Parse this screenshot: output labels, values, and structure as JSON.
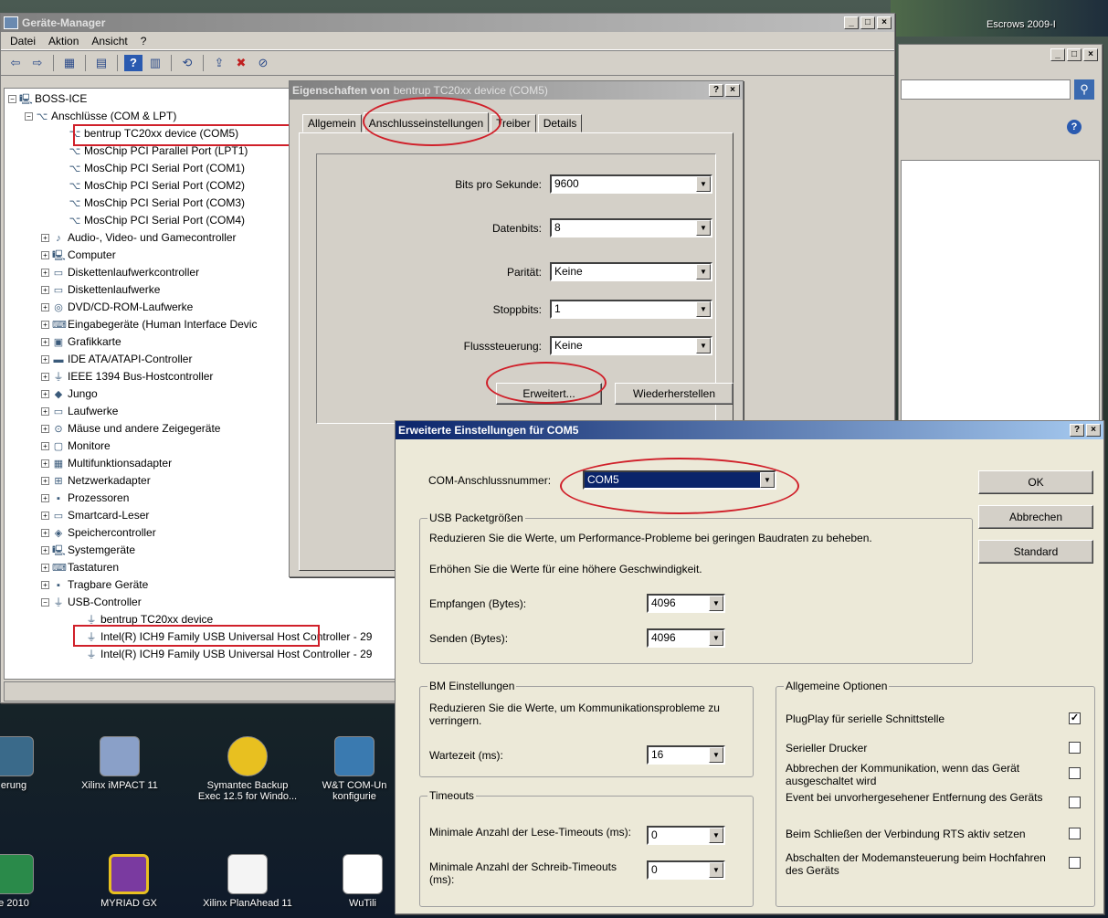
{
  "desktop": {
    "escrows_label": "Escrows 2009-I",
    "icons": [
      {
        "label": "erung"
      },
      {
        "label": "Xilinx iMPACT 11"
      },
      {
        "label": "Symantec Backup Exec 12.5 for Windo..."
      },
      {
        "label": "W&T COM-Un konfigurie"
      },
      {
        "label": "e 2010"
      },
      {
        "label": "MYRIAD GX"
      },
      {
        "label": "Xilinx PlanAhead 11"
      },
      {
        "label": "WuTili"
      }
    ]
  },
  "device_manager": {
    "title": "Geräte-Manager",
    "menu": [
      "Datei",
      "Aktion",
      "Ansicht",
      "?"
    ],
    "tree": [
      {
        "label": "BOSS-ICE",
        "level": 0,
        "expander": "−"
      },
      {
        "label": "Anschlüsse (COM & LPT)",
        "level": 1,
        "expander": "−"
      },
      {
        "label": "bentrup TC20xx device (COM5)",
        "level": 2,
        "expander": ""
      },
      {
        "label": "MosChip PCI Parallel Port (LPT1)",
        "level": 2,
        "expander": ""
      },
      {
        "label": "MosChip PCI Serial Port (COM1)",
        "level": 2,
        "expander": ""
      },
      {
        "label": "MosChip PCI Serial Port (COM2)",
        "level": 2,
        "expander": ""
      },
      {
        "label": "MosChip PCI Serial Port (COM3)",
        "level": 2,
        "expander": ""
      },
      {
        "label": "MosChip PCI Serial Port (COM4)",
        "level": 2,
        "expander": ""
      },
      {
        "label": "Audio-, Video- und Gamecontroller",
        "level": 1,
        "expander": "+"
      },
      {
        "label": "Computer",
        "level": 1,
        "expander": "+"
      },
      {
        "label": "Diskettenlaufwerkcontroller",
        "level": 1,
        "expander": "+"
      },
      {
        "label": "Diskettenlaufwerke",
        "level": 1,
        "expander": "+"
      },
      {
        "label": "DVD/CD-ROM-Laufwerke",
        "level": 1,
        "expander": "+"
      },
      {
        "label": "Eingabegeräte (Human Interface Devic",
        "level": 1,
        "expander": "+"
      },
      {
        "label": "Grafikkarte",
        "level": 1,
        "expander": "+"
      },
      {
        "label": "IDE ATA/ATAPI-Controller",
        "level": 1,
        "expander": "+"
      },
      {
        "label": "IEEE 1394 Bus-Hostcontroller",
        "level": 1,
        "expander": "+"
      },
      {
        "label": "Jungo",
        "level": 1,
        "expander": "+"
      },
      {
        "label": "Laufwerke",
        "level": 1,
        "expander": "+"
      },
      {
        "label": "Mäuse und andere Zeigegeräte",
        "level": 1,
        "expander": "+"
      },
      {
        "label": "Monitore",
        "level": 1,
        "expander": "+"
      },
      {
        "label": "Multifunktionsadapter",
        "level": 1,
        "expander": "+"
      },
      {
        "label": "Netzwerkadapter",
        "level": 1,
        "expander": "+"
      },
      {
        "label": "Prozessoren",
        "level": 1,
        "expander": "+"
      },
      {
        "label": "Smartcard-Leser",
        "level": 1,
        "expander": "+"
      },
      {
        "label": "Speichercontroller",
        "level": 1,
        "expander": "+"
      },
      {
        "label": "Systemgeräte",
        "level": 1,
        "expander": "+"
      },
      {
        "label": "Tastaturen",
        "level": 1,
        "expander": "+"
      },
      {
        "label": "Tragbare Geräte",
        "level": 1,
        "expander": "+"
      },
      {
        "label": "USB-Controller",
        "level": 1,
        "expander": "−"
      },
      {
        "label": "bentrup TC20xx device",
        "level": 2,
        "expander": ""
      },
      {
        "label": "Intel(R) ICH9 Family USB Universal Host Controller - 29",
        "level": 2,
        "expander": ""
      },
      {
        "label": "Intel(R) ICH9 Family USB Universal Host Controller - 29",
        "level": 2,
        "expander": ""
      }
    ]
  },
  "properties_dialog": {
    "title_prefix": "Eigenschaften von",
    "title_device": "bentrup TC20xx device (COM5)",
    "tabs": [
      "Allgemein",
      "Anschlusseinstellungen",
      "Treiber",
      "Details"
    ],
    "active_tab": "Anschlusseinstellungen",
    "fields": [
      {
        "label": "Bits pro Sekunde:",
        "value": "9600"
      },
      {
        "label": "Datenbits:",
        "value": "8"
      },
      {
        "label": "Parität:",
        "value": "Keine"
      },
      {
        "label": "Stoppbits:",
        "value": "1"
      },
      {
        "label": "Flusssteuerung:",
        "value": "Keine"
      }
    ],
    "advanced_button": "Erweitert...",
    "restore_button": "Wiederherstellen"
  },
  "advanced_dialog": {
    "title": "Erweiterte Einstellungen für COM5",
    "com_label": "COM-Anschlussnummer:",
    "com_value": "COM5",
    "ok": "OK",
    "cancel": "Abbrechen",
    "standard": "Standard",
    "usb_group": {
      "legend": "USB Packetgrößen",
      "hint1": "Reduzieren Sie die Werte, um Performance-Probleme bei geringen Baudraten zu beheben.",
      "hint2": "Erhöhen Sie die Werte für eine höhere Geschwindigkeit.",
      "receive_label": "Empfangen (Bytes):",
      "receive_value": "4096",
      "send_label": "Senden (Bytes):",
      "send_value": "4096"
    },
    "bm_group": {
      "legend": "BM Einstellungen",
      "hint": "Reduzieren Sie die Werte, um Kommunikationsprobleme zu verringern.",
      "latency_label": "Wartezeit (ms):",
      "latency_value": "16"
    },
    "timeouts_group": {
      "legend": "Timeouts",
      "read_label": "Minimale Anzahl der Lese-Timeouts (ms):",
      "read_value": "0",
      "write_label": "Minimale Anzahl der Schreib-Timeouts (ms):",
      "write_value": "0"
    },
    "general_group": {
      "legend": "Allgemeine Optionen",
      "options": [
        {
          "label": "PlugPlay für serielle Schnittstelle",
          "checked": true
        },
        {
          "label": "Serieller Drucker",
          "checked": false
        },
        {
          "label": "Abbrechen der Kommunikation, wenn das Gerät ausgeschaltet wird",
          "checked": false
        },
        {
          "label": "Event bei unvorhergesehener Entfernung des Geräts",
          "checked": false
        },
        {
          "label": "Beim Schließen der Verbindung RTS aktiv setzen",
          "checked": false
        },
        {
          "label": "Abschalten der Modemansteuerung beim Hochfahren des Geräts",
          "checked": false
        }
      ]
    }
  }
}
